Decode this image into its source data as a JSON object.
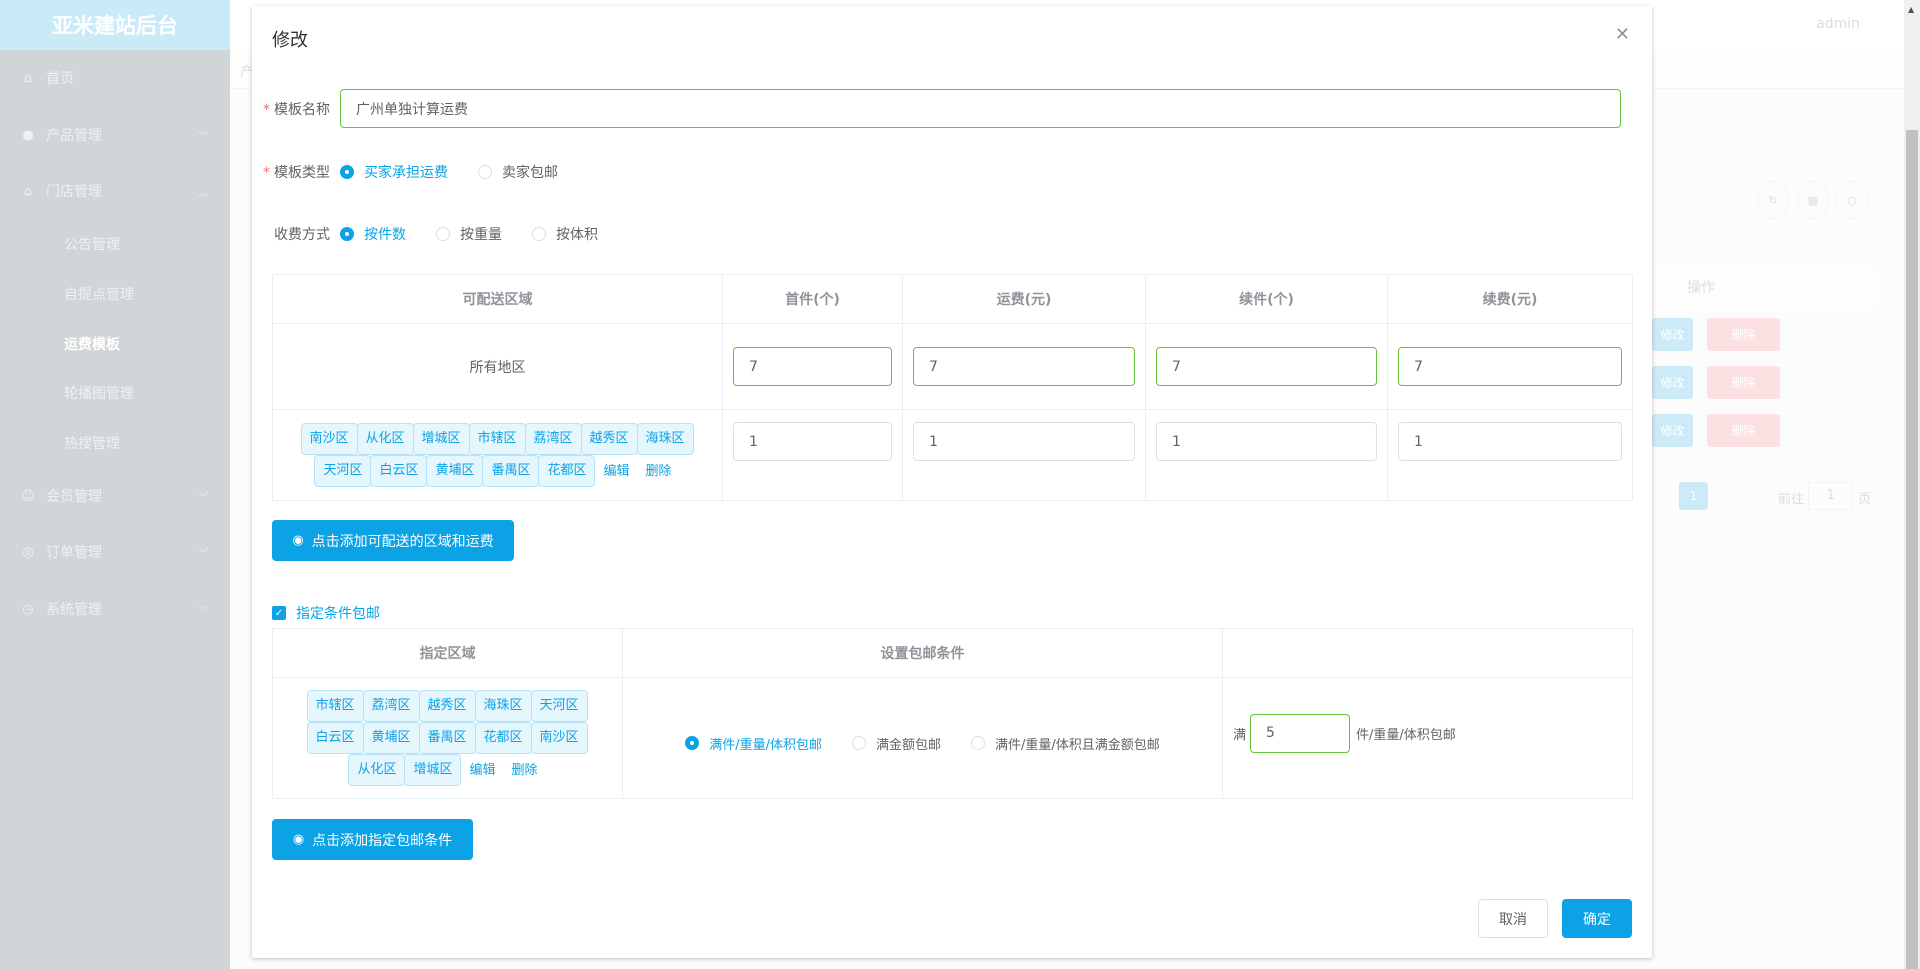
{
  "sidebar": {
    "logo": "亚米建站后台",
    "items": [
      {
        "label": "首页",
        "icon": "home-icon"
      },
      {
        "label": "产品管理",
        "icon": "user-icon"
      },
      {
        "label": "门店管理",
        "icon": "shop-icon"
      },
      {
        "label": "公告管理"
      },
      {
        "label": "自提点管理"
      },
      {
        "label": "运费模板",
        "active": true
      },
      {
        "label": "轮播图管理"
      },
      {
        "label": "热搜管理"
      },
      {
        "label": "会员管理",
        "icon": "member-icon"
      },
      {
        "label": "订单管理",
        "icon": "order-icon"
      },
      {
        "label": "系统管理",
        "icon": "settings-icon"
      }
    ]
  },
  "header": {
    "user": "admin",
    "breadcrumb": "产"
  },
  "background": {
    "column_header": "操作",
    "edit_label": "修改",
    "delete_label": "删除",
    "page_current": "1",
    "goto_label": "前往",
    "goto_value": "1",
    "page_suffix": "页"
  },
  "dialog": {
    "title": "修改",
    "template_name_label": "模板名称",
    "template_name_value": "广州单独计算运费",
    "template_type_label": "模板类型",
    "template_type_options": [
      "买家承担运费",
      "卖家包邮"
    ],
    "template_type_selected": "买家承担运费",
    "charge_method_label": "收费方式",
    "charge_method_options": [
      "按件数",
      "按重量",
      "按体积"
    ],
    "charge_method_selected": "按件数",
    "shipping_table": {
      "headers": [
        "可配送区域",
        "首件(个)",
        "运费(元)",
        "续件(个)",
        "续费(元)"
      ],
      "rows": [
        {
          "region": "所有地区",
          "values": [
            "7",
            "7",
            "7",
            "7"
          ]
        },
        {
          "regions": [
            "南沙区",
            "从化区",
            "增城区",
            "市辖区",
            "荔湾区",
            "越秀区",
            "海珠区",
            "天河区",
            "白云区",
            "黄埔区",
            "番禺区",
            "花都区"
          ],
          "edit": "编辑",
          "delete": "删除",
          "values": [
            "1",
            "1",
            "1",
            "1"
          ]
        }
      ]
    },
    "add_region_button": "点击添加可配送的区域和运费",
    "free_shipping_checkbox": "指定条件包邮",
    "free_shipping_checked": true,
    "free_table": {
      "headers": [
        "指定区域",
        "设置包邮条件",
        ""
      ],
      "regions": [
        "市辖区",
        "荔湾区",
        "越秀区",
        "海珠区",
        "天河区",
        "白云区",
        "黄埔区",
        "番禺区",
        "花都区",
        "南沙区",
        "从化区",
        "增城区"
      ],
      "edit": "编辑",
      "delete": "删除",
      "condition_options": [
        "满件/重量/体积包邮",
        "满金额包邮",
        "满件/重量/体积且满金额包邮"
      ],
      "condition_selected": "满件/重量/体积包邮",
      "prefix": "满",
      "value": "5",
      "suffix": "件/重量/体积包邮"
    },
    "add_condition_button": "点击添加指定包邮条件",
    "cancel": "取消",
    "confirm": "确定"
  },
  "colors": {
    "primary": "#0ba3e6",
    "valid_border": "#67c23a",
    "required": "#f56c6c"
  }
}
